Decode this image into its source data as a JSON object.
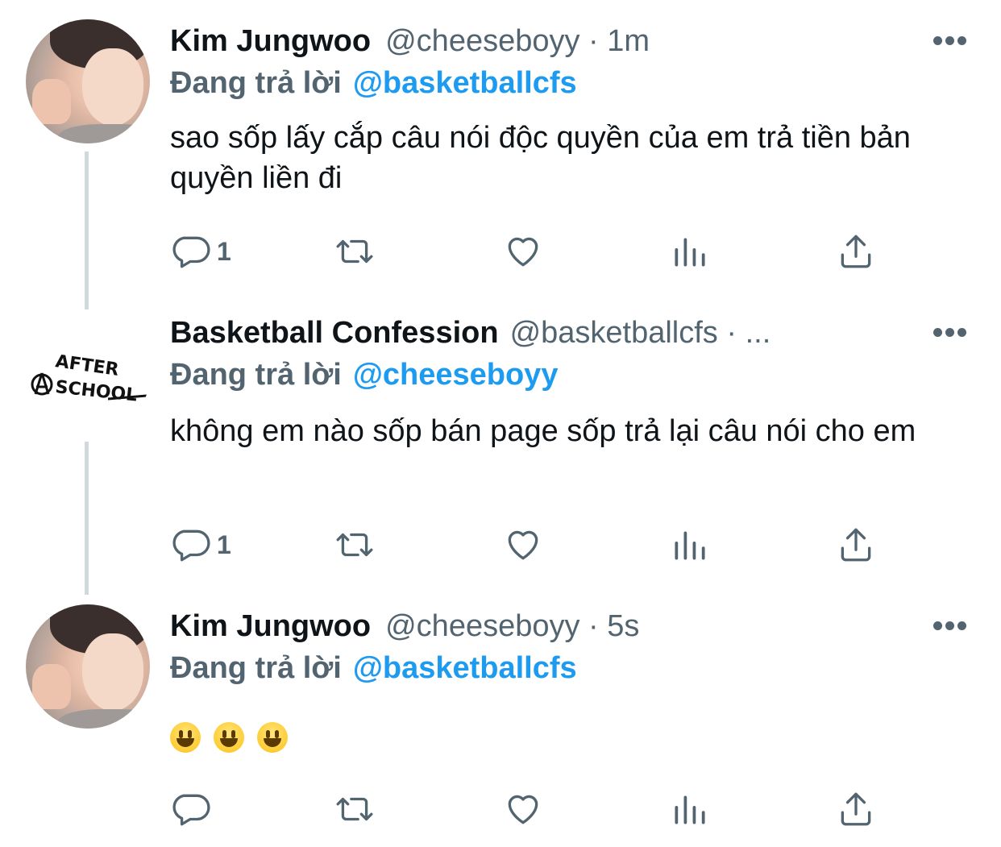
{
  "tweets": [
    {
      "name": "Kim Jungwoo",
      "handle": "@cheeseboyy · 1m",
      "reply_label": "Đang trả lời",
      "reply_to": "@basketballcfs",
      "text": "sao sốp lấy cắp câu nói độc quyền của em trả tiền bản quyền liền đi",
      "reply_count": "1",
      "avatar": "jungwoo-photo"
    },
    {
      "name": "Basketball Confession",
      "handle": "@basketballcfs · ...",
      "reply_label": "Đang trả lời",
      "reply_to": "@cheeseboyy",
      "text": "không em nào sốp bán page sốp trả lại câu nói cho em",
      "reply_count": "1",
      "avatar_logo_text_1": "AFTER",
      "avatar_logo_text_2": "SCHOOL"
    },
    {
      "name": "Kim Jungwoo",
      "handle": "@cheeseboyy · 5s",
      "reply_label": "Đang trả lời",
      "reply_to": "@basketballcfs",
      "emoji_count": 3,
      "emoji": "grinning-face",
      "avatar": "jungwoo-photo"
    }
  ],
  "icons": [
    "reply-icon",
    "retweet-icon",
    "like-icon",
    "analytics-icon",
    "share-icon",
    "more-icon"
  ],
  "colors": {
    "link": "#1d9bf0",
    "secondary": "#536471",
    "text": "#0f1419",
    "thread_line": "#cfd9de"
  }
}
